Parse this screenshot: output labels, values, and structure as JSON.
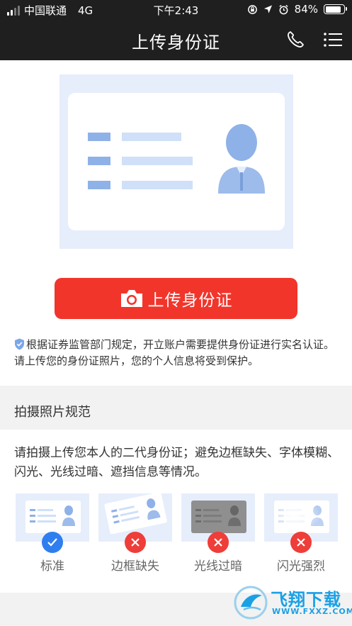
{
  "status_bar": {
    "carrier": "中国联通",
    "network": "4G",
    "time": "下午2:43",
    "battery": "84%",
    "battery_level": 0.84
  },
  "nav": {
    "title": "上传身份证",
    "icons": [
      "phone-icon",
      "menu-list-icon"
    ]
  },
  "upload": {
    "button_label": "上传身份证",
    "button_icon": "camera-icon",
    "notice": "根据证券监管部门规定，开立账户需要提供身份证进行实名认证。请上传您的身份证照片，您的个人信息将受到保护。"
  },
  "spec": {
    "title": "拍摄照片规范",
    "description": "请拍摄上传您本人的二代身份证；避免边框缺失、字体模糊、闪光、光线过暗、遮挡信息等情况。",
    "samples": [
      {
        "label": "标准",
        "status": "ok"
      },
      {
        "label": "边框缺失",
        "status": "bad"
      },
      {
        "label": "光线过暗",
        "status": "bad"
      },
      {
        "label": "闪光强烈",
        "status": "bad"
      }
    ]
  },
  "watermark": {
    "text": "飞翔下载",
    "url": "WWW.FXXZ.COM"
  },
  "colors": {
    "bar_bg": "#1f1f1f",
    "accent_red": "#f2352b",
    "ok_blue": "#2f7ef0",
    "card_blue": "#e6eefc"
  }
}
